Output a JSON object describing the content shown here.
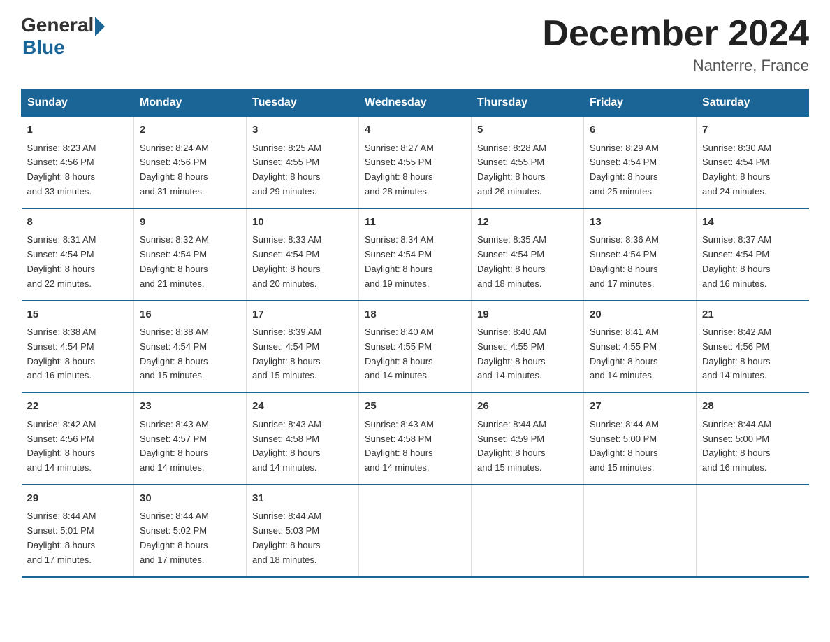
{
  "header": {
    "logo_general": "General",
    "logo_blue": "Blue",
    "month_title": "December 2024",
    "location": "Nanterre, France"
  },
  "days_of_week": [
    "Sunday",
    "Monday",
    "Tuesday",
    "Wednesday",
    "Thursday",
    "Friday",
    "Saturday"
  ],
  "weeks": [
    [
      {
        "day": "1",
        "sunrise": "8:23 AM",
        "sunset": "4:56 PM",
        "daylight": "8 hours and 33 minutes."
      },
      {
        "day": "2",
        "sunrise": "8:24 AM",
        "sunset": "4:56 PM",
        "daylight": "8 hours and 31 minutes."
      },
      {
        "day": "3",
        "sunrise": "8:25 AM",
        "sunset": "4:55 PM",
        "daylight": "8 hours and 29 minutes."
      },
      {
        "day": "4",
        "sunrise": "8:27 AM",
        "sunset": "4:55 PM",
        "daylight": "8 hours and 28 minutes."
      },
      {
        "day": "5",
        "sunrise": "8:28 AM",
        "sunset": "4:55 PM",
        "daylight": "8 hours and 26 minutes."
      },
      {
        "day": "6",
        "sunrise": "8:29 AM",
        "sunset": "4:54 PM",
        "daylight": "8 hours and 25 minutes."
      },
      {
        "day": "7",
        "sunrise": "8:30 AM",
        "sunset": "4:54 PM",
        "daylight": "8 hours and 24 minutes."
      }
    ],
    [
      {
        "day": "8",
        "sunrise": "8:31 AM",
        "sunset": "4:54 PM",
        "daylight": "8 hours and 22 minutes."
      },
      {
        "day": "9",
        "sunrise": "8:32 AM",
        "sunset": "4:54 PM",
        "daylight": "8 hours and 21 minutes."
      },
      {
        "day": "10",
        "sunrise": "8:33 AM",
        "sunset": "4:54 PM",
        "daylight": "8 hours and 20 minutes."
      },
      {
        "day": "11",
        "sunrise": "8:34 AM",
        "sunset": "4:54 PM",
        "daylight": "8 hours and 19 minutes."
      },
      {
        "day": "12",
        "sunrise": "8:35 AM",
        "sunset": "4:54 PM",
        "daylight": "8 hours and 18 minutes."
      },
      {
        "day": "13",
        "sunrise": "8:36 AM",
        "sunset": "4:54 PM",
        "daylight": "8 hours and 17 minutes."
      },
      {
        "day": "14",
        "sunrise": "8:37 AM",
        "sunset": "4:54 PM",
        "daylight": "8 hours and 16 minutes."
      }
    ],
    [
      {
        "day": "15",
        "sunrise": "8:38 AM",
        "sunset": "4:54 PM",
        "daylight": "8 hours and 16 minutes."
      },
      {
        "day": "16",
        "sunrise": "8:38 AM",
        "sunset": "4:54 PM",
        "daylight": "8 hours and 15 minutes."
      },
      {
        "day": "17",
        "sunrise": "8:39 AM",
        "sunset": "4:54 PM",
        "daylight": "8 hours and 15 minutes."
      },
      {
        "day": "18",
        "sunrise": "8:40 AM",
        "sunset": "4:55 PM",
        "daylight": "8 hours and 14 minutes."
      },
      {
        "day": "19",
        "sunrise": "8:40 AM",
        "sunset": "4:55 PM",
        "daylight": "8 hours and 14 minutes."
      },
      {
        "day": "20",
        "sunrise": "8:41 AM",
        "sunset": "4:55 PM",
        "daylight": "8 hours and 14 minutes."
      },
      {
        "day": "21",
        "sunrise": "8:42 AM",
        "sunset": "4:56 PM",
        "daylight": "8 hours and 14 minutes."
      }
    ],
    [
      {
        "day": "22",
        "sunrise": "8:42 AM",
        "sunset": "4:56 PM",
        "daylight": "8 hours and 14 minutes."
      },
      {
        "day": "23",
        "sunrise": "8:43 AM",
        "sunset": "4:57 PM",
        "daylight": "8 hours and 14 minutes."
      },
      {
        "day": "24",
        "sunrise": "8:43 AM",
        "sunset": "4:58 PM",
        "daylight": "8 hours and 14 minutes."
      },
      {
        "day": "25",
        "sunrise": "8:43 AM",
        "sunset": "4:58 PM",
        "daylight": "8 hours and 14 minutes."
      },
      {
        "day": "26",
        "sunrise": "8:44 AM",
        "sunset": "4:59 PM",
        "daylight": "8 hours and 15 minutes."
      },
      {
        "day": "27",
        "sunrise": "8:44 AM",
        "sunset": "5:00 PM",
        "daylight": "8 hours and 15 minutes."
      },
      {
        "day": "28",
        "sunrise": "8:44 AM",
        "sunset": "5:00 PM",
        "daylight": "8 hours and 16 minutes."
      }
    ],
    [
      {
        "day": "29",
        "sunrise": "8:44 AM",
        "sunset": "5:01 PM",
        "daylight": "8 hours and 17 minutes."
      },
      {
        "day": "30",
        "sunrise": "8:44 AM",
        "sunset": "5:02 PM",
        "daylight": "8 hours and 17 minutes."
      },
      {
        "day": "31",
        "sunrise": "8:44 AM",
        "sunset": "5:03 PM",
        "daylight": "8 hours and 18 minutes."
      },
      {
        "day": "",
        "sunrise": "",
        "sunset": "",
        "daylight": ""
      },
      {
        "day": "",
        "sunrise": "",
        "sunset": "",
        "daylight": ""
      },
      {
        "day": "",
        "sunrise": "",
        "sunset": "",
        "daylight": ""
      },
      {
        "day": "",
        "sunrise": "",
        "sunset": "",
        "daylight": ""
      }
    ]
  ],
  "labels": {
    "sunrise": "Sunrise:",
    "sunset": "Sunset:",
    "daylight": "Daylight:"
  }
}
